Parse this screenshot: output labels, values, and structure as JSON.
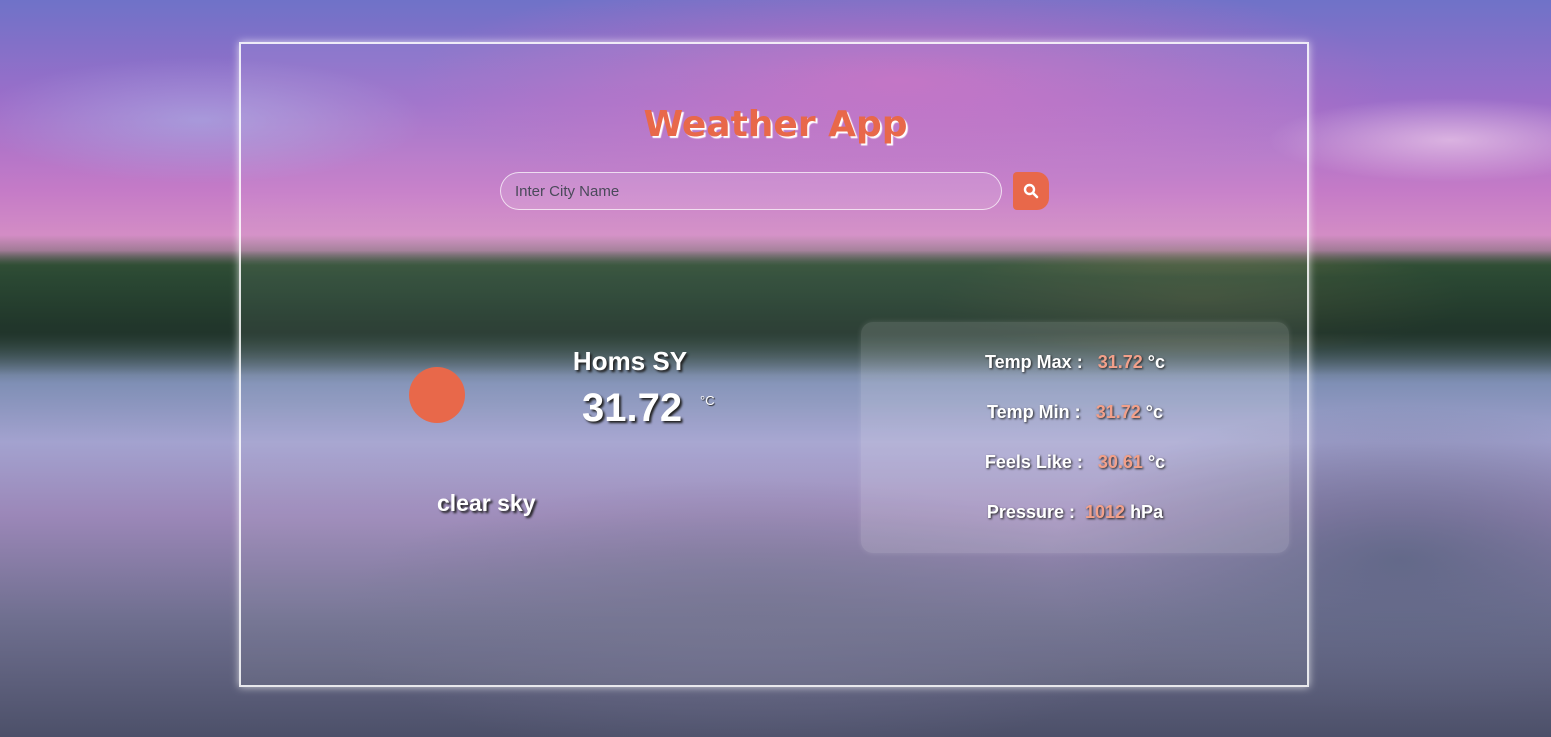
{
  "app": {
    "title": "Weather App"
  },
  "search": {
    "placeholder": "Inter City Name",
    "button_icon": "search-icon"
  },
  "current": {
    "city": "Homs SY",
    "temperature": "31.72",
    "unit": "°C",
    "description": "clear sky",
    "icon": "sun-icon"
  },
  "details": [
    {
      "label": "Temp Max :",
      "value": "31.72",
      "unit": "°c"
    },
    {
      "label": "Temp Min :",
      "value": "31.72",
      "unit": "°c"
    },
    {
      "label": "Feels Like :",
      "value": "30.61",
      "unit": "°c"
    },
    {
      "label": "Pressure :",
      "value": "1012",
      "unit": "hPa"
    }
  ],
  "colors": {
    "accent": "#e8684a",
    "value": "#f2a08a",
    "text": "#ffffff"
  }
}
